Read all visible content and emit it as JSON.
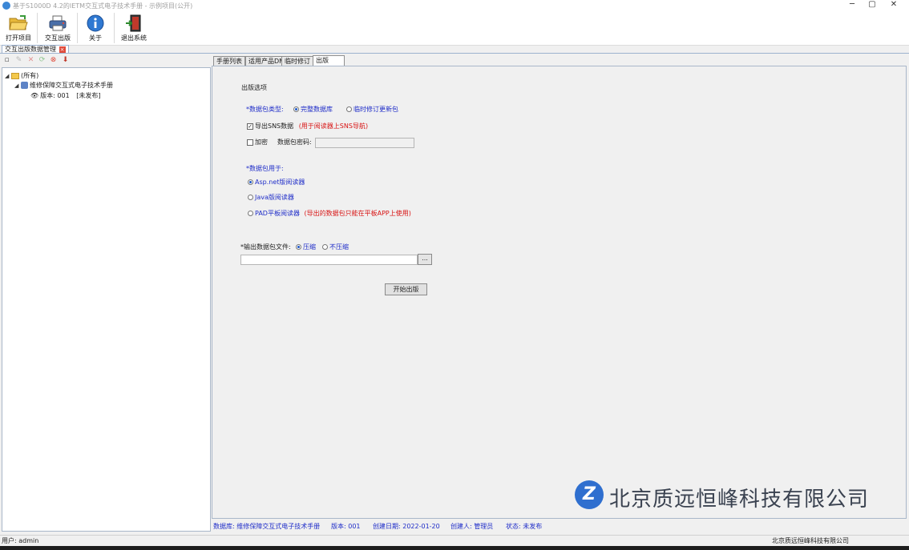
{
  "window": {
    "title": "基于S1000D 4.2的IETM交互式电子技术手册 - 示例项目(公开)",
    "minimize": "─",
    "maximize": "▢",
    "close": "✕"
  },
  "toolbar": {
    "open_project": "打开项目",
    "interactive_publish": "交互出版",
    "about": "关于",
    "exit": "退出系统"
  },
  "module_tab": {
    "label": "交互出版数据管理",
    "close_icon": "×"
  },
  "left_tools": [
    "new-icon",
    "edit-icon",
    "delete-icon",
    "refresh-icon",
    "stop-icon",
    "export-icon"
  ],
  "tree": {
    "root": "(所有)",
    "book": "维修保障交互式电子技术手册",
    "version": "版本: 001",
    "version_status": "[未发布]"
  },
  "tabs": [
    "手册列表",
    "适用产品DM",
    "临时修订",
    "出版"
  ],
  "active_tab": 3,
  "publish": {
    "group_title": "出版选项",
    "package_type_label": "*数据包类型:",
    "package_full": "完整数据库",
    "package_temp": "临时修订更新包",
    "export_sns": "导出SNS数据",
    "export_sns_note": "(用于阅读器上SNS导航)",
    "encrypt": "加密",
    "password_label": "数据包密码:",
    "password_value": "",
    "usage_label": "*数据包用于:",
    "reader_asp": "Asp.net版阅读器",
    "reader_java": "Java版阅读器",
    "reader_pad": "PAD平板阅读器",
    "reader_pad_note": "(导出的数据包只能在平板APP上使用)",
    "output_label": "*输出数据包文件:",
    "compress": "压缩",
    "no_compress": "不压缩",
    "output_path": "",
    "browse": "...",
    "start": "开始出版"
  },
  "watermark": {
    "company": "北京质远恒峰科技有限公司"
  },
  "info": {
    "database": "数据库: 维修保障交互式电子技术手册",
    "version": "版本: 001",
    "created": "创建日期: 2022-01-20",
    "creator": "创建人: 管理员",
    "status": "状态: 未发布"
  },
  "statusbar": {
    "user": "用户: admin",
    "company": "北京质远恒峰科技有限公司"
  },
  "colors": {
    "accent_blue": "#1e2cc8",
    "note_red": "#d81414",
    "logo_blue": "#2f6fcf"
  }
}
